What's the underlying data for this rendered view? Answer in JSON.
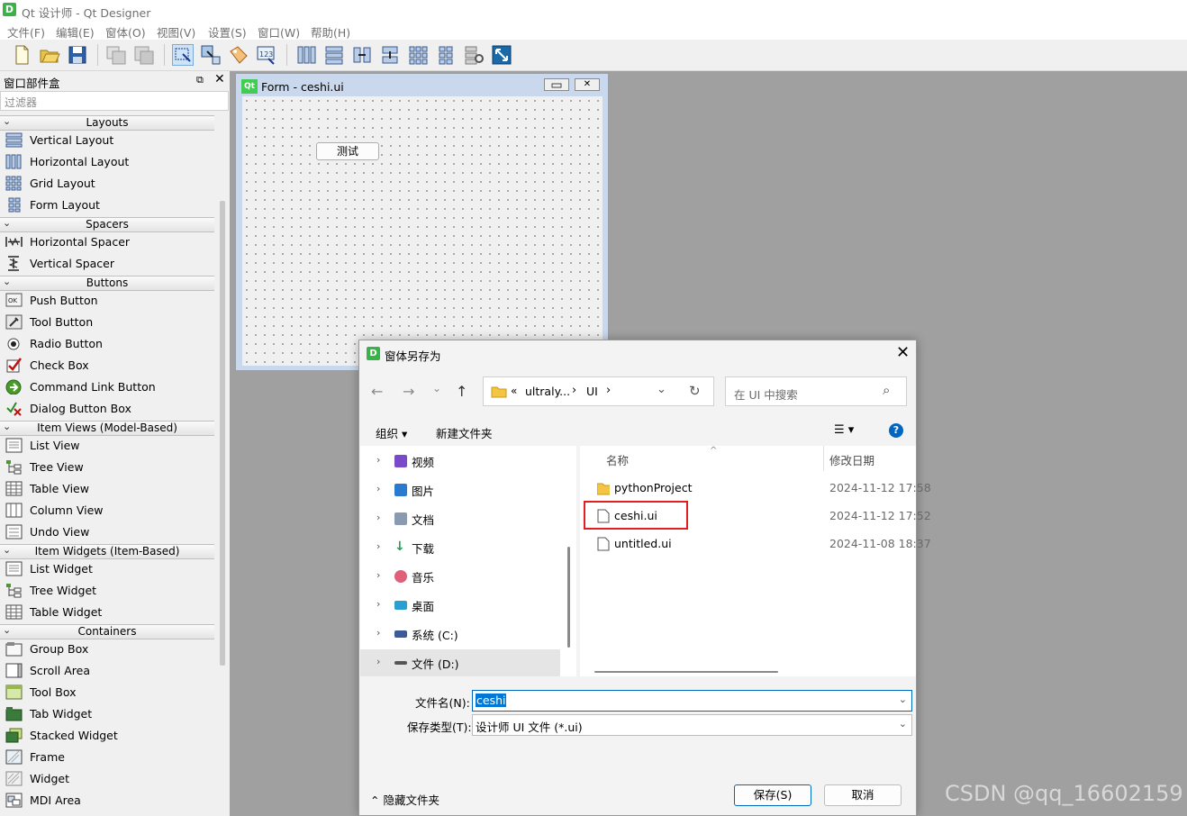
{
  "app": {
    "title": "Qt 设计师 - Qt Designer",
    "icon_letter": "D"
  },
  "menu": [
    "文件(F)",
    "编辑(E)",
    "窗体(O)",
    "视图(V)",
    "设置(S)",
    "窗口(W)",
    "帮助(H)"
  ],
  "widget_box": {
    "title": "窗口部件盒",
    "float_icon": "⧉",
    "close_icon": "✕",
    "filter_placeholder": "过滤器",
    "categories": {
      "layouts": "Layouts",
      "spacers": "Spacers",
      "buttons": "Buttons",
      "item_views": "Item Views (Model-Based)",
      "item_widgets": "Item Widgets (Item-Based)",
      "containers": "Containers"
    },
    "items": {
      "vertical_layout": "Vertical Layout",
      "horizontal_layout": "Horizontal Layout",
      "grid_layout": "Grid Layout",
      "form_layout": "Form Layout",
      "horizontal_spacer": "Horizontal Spacer",
      "vertical_spacer": "Vertical Spacer",
      "push_button": "Push Button",
      "tool_button": "Tool Button",
      "radio_button": "Radio Button",
      "check_box": "Check Box",
      "command_link_button": "Command Link Button",
      "dialog_button_box": "Dialog Button Box",
      "list_view": "List View",
      "tree_view": "Tree View",
      "table_view": "Table View",
      "column_view": "Column View",
      "undo_view": "Undo View",
      "list_widget": "List Widget",
      "tree_widget": "Tree Widget",
      "table_widget": "Table Widget",
      "group_box": "Group Box",
      "scroll_area": "Scroll Area",
      "tool_box": "Tool Box",
      "tab_widget": "Tab Widget",
      "stacked_widget": "Stacked Widget",
      "frame": "Frame",
      "widget": "Widget",
      "mdi_area": "MDI Area"
    }
  },
  "form": {
    "title": "Form - ceshi.ui",
    "qt_logo": "Qt",
    "button_label": "测试",
    "max_icon": "✕"
  },
  "dialog": {
    "title": "窗体另存为",
    "icon_letter": "D",
    "close_icon": "✕",
    "nav": {
      "back": "←",
      "forward": "→",
      "history": "⌄",
      "up": "↑"
    },
    "address": {
      "prefix": "«",
      "seg1": "ultraly...",
      "sep": "›",
      "seg2": "UI",
      "sep2": "›",
      "dropdown": "⌄",
      "refresh": "↻"
    },
    "search_placeholder": "在 UI 中搜索",
    "search_icon": "⌕",
    "organize": "组织 ▾",
    "new_folder": "新建文件夹",
    "view_icon": "☰ ▾",
    "help_icon": "?",
    "nav_pane": [
      "视频",
      "图片",
      "文档",
      "下载",
      "音乐",
      "桌面",
      "系统 (C:)",
      "文件 (D:)"
    ],
    "columns": {
      "name": "名称",
      "modified": "修改日期",
      "sort": "^"
    },
    "files": [
      {
        "name": "pythonProject",
        "date": "2024-11-12 17:58",
        "type": "folder"
      },
      {
        "name": "ceshi.ui",
        "date": "2024-11-12 17:52",
        "type": "file"
      },
      {
        "name": "untitled.ui",
        "date": "2024-11-08 18:37",
        "type": "file"
      }
    ],
    "filename_label": "文件名(N):",
    "filename_value": "ceshi",
    "filetype_label": "保存类型(T):",
    "filetype_value": "设计师 UI 文件 (*.ui)",
    "dropdown_arrow": "⌄",
    "hide_folders": "⌃ 隐藏文件夹",
    "save": "保存(S)",
    "cancel": "取消"
  },
  "watermark": "CSDN @qq_16602159",
  "colors": {
    "accent": "#0067c0",
    "selection": "#0078d7",
    "highlight_box": "#e02020",
    "app_icon": "#3ab24a"
  }
}
